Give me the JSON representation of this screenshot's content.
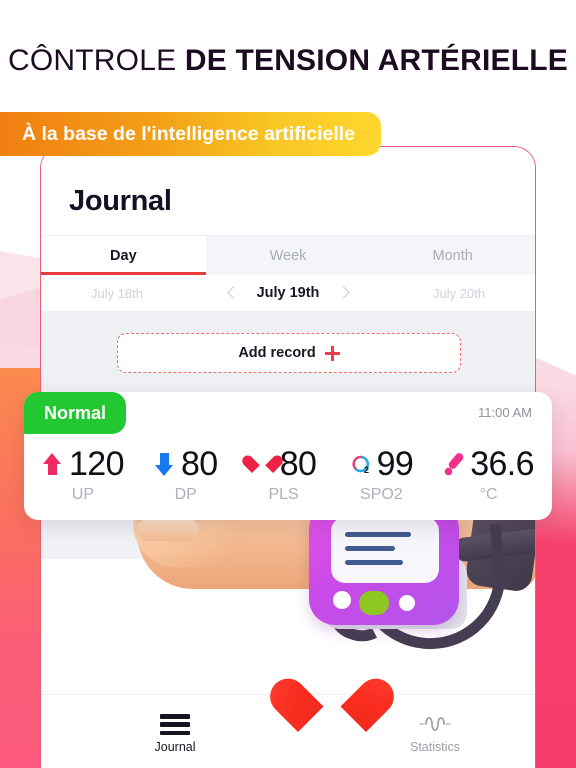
{
  "promo": {
    "headline_light": "CÔNTROLE ",
    "headline_bold": "DE TENSION ARTÉRIELLE",
    "banner": "À la base de l'intelligence artificielle"
  },
  "app": {
    "page_title": "Journal",
    "tabs": [
      {
        "label": "Day",
        "active": true
      },
      {
        "label": "Week",
        "active": false
      },
      {
        "label": "Month",
        "active": false
      }
    ],
    "date_nav": {
      "previous": "July 18th",
      "current": "July 19th",
      "next": "July 20th",
      "prev_icon": "chevron-left-icon",
      "next_icon": "chevron-right-icon"
    },
    "add_record": {
      "label": "Add record",
      "icon": "plus-icon"
    },
    "record_card": {
      "status": "Normal",
      "status_color": "#22c832",
      "time": "11:00 AM",
      "metrics": [
        {
          "icon": "arrow-up-icon",
          "icon_color": "#ef2a5e",
          "value": "120",
          "label": "UP"
        },
        {
          "icon": "arrow-down-icon",
          "icon_color": "#1878f0",
          "value": "80",
          "label": "DP"
        },
        {
          "icon": "heart-icon",
          "icon_color": "#ef2246",
          "value": "80",
          "label": "PLS"
        },
        {
          "icon": "oxygen-ring-icon",
          "icon_color": "#e0457e",
          "value": "99",
          "label": "SPO2"
        },
        {
          "icon": "thermometer-icon",
          "icon_color": "#ef2a8e",
          "value": "36.6",
          "label": "°C"
        }
      ]
    },
    "bottom_nav": {
      "journal": {
        "label": "Journal",
        "icon": "hamburger-icon",
        "active": true
      },
      "statistics": {
        "label": "Statistics",
        "icon": "waveform-icon",
        "active": false
      },
      "fab": {
        "icon": "heart-plus-icon",
        "color": "#f92c1f"
      }
    }
  }
}
